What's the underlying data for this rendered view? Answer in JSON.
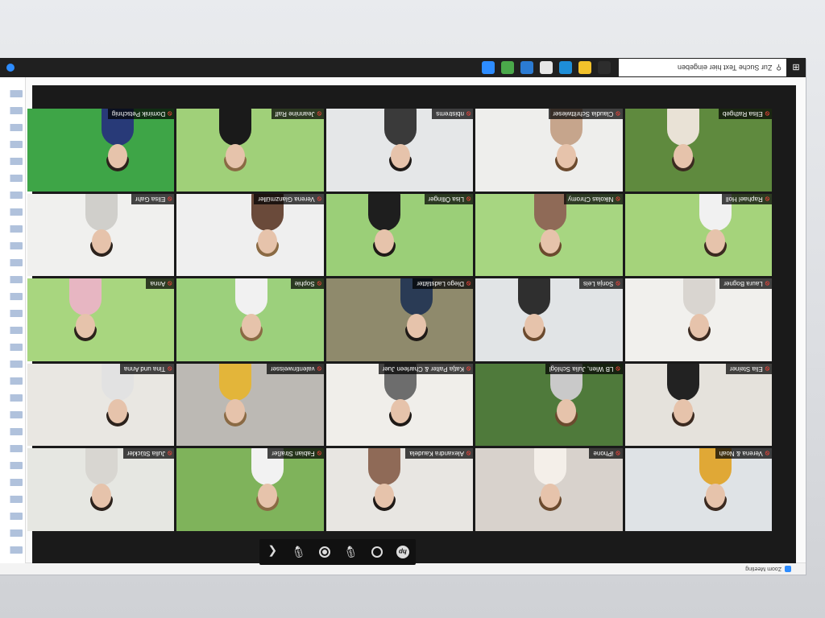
{
  "zoom_window": {
    "title": "Zoom Meeting"
  },
  "toolbar": {
    "items": [
      "hp-logo",
      "ring",
      "mic-icon",
      "record",
      "mic-icon",
      "chevron"
    ]
  },
  "participants": [
    {
      "name": "Verena & Noah",
      "scene": "#dfe3e6",
      "shirt": "#e0a836"
    },
    {
      "name": "iPhone",
      "scene": "#d8d2cc",
      "shirt": "#f4efe9"
    },
    {
      "name": "Alexandra Kaudela",
      "scene": "#e8e6e2",
      "shirt": "#8f6a57"
    },
    {
      "name": "Fabian Straßer",
      "scene": "#7fb35b",
      "shirt": "#f2f2f2"
    },
    {
      "name": "Julia Stückler",
      "scene": "#e6e7e2",
      "shirt": "#d8d6d1"
    },
    {
      "name": "Elia Steiner",
      "scene": "#e5e2dc",
      "shirt": "#222222"
    },
    {
      "name": "LB Wien, Julia Schlögl",
      "scene": "#4f7a3b",
      "shirt": "#c9c9c9"
    },
    {
      "name": "Katja Palter & Charleen Juer",
      "scene": "#f0eeea",
      "shirt": "#6d6d6d"
    },
    {
      "name": "valentinweisser",
      "scene": "#bcb9b4",
      "shirt": "#e3b53a"
    },
    {
      "name": "Tina und Anna",
      "scene": "#e9e7e2",
      "shirt": "#e2e2e2"
    },
    {
      "name": "Laura Bogner",
      "scene": "#f1f0ed",
      "shirt": "#d9d5d0"
    },
    {
      "name": "Sonja Leis",
      "scene": "#e1e4e6",
      "shirt": "#2f2f2f"
    },
    {
      "name": "Diego Ladstätter",
      "scene": "#8f8a6c",
      "shirt": "#2a3b55"
    },
    {
      "name": "Sophie",
      "scene": "#9cd07c",
      "shirt": "#f1f1f1"
    },
    {
      "name": "Anna",
      "scene": "#a8d67f",
      "shirt": "#e7b6c2"
    },
    {
      "name": "Raphael Holl",
      "scene": "#a5d37b",
      "shirt": "#f1f1f1"
    },
    {
      "name": "Nikolas Chromy",
      "scene": "#a7d681",
      "shirt": "#8f6a57"
    },
    {
      "name": "Lisa Öllinger",
      "scene": "#9bcf78",
      "shirt": "#1e1e1e"
    },
    {
      "name": "Verena Glanzmüller",
      "scene": "#efefef",
      "shirt": "#6a4a3a"
    },
    {
      "name": "Elisa Gahr",
      "scene": "#f0f0ee",
      "shirt": "#d0cfcb"
    },
    {
      "name": "Elisa Rathgeb",
      "scene": "#5f8a3e",
      "shirt": "#e9e2d6"
    },
    {
      "name": "Claudia Schrittwieser",
      "scene": "#eeeeec",
      "shirt": "#c6a58c"
    },
    {
      "name": "nbistrems",
      "scene": "#e5e7e8",
      "shirt": "#3a3a3a"
    },
    {
      "name": "Jeannine Ralf",
      "scene": "#a0d079",
      "shirt": "#1a1a1a"
    },
    {
      "name": "Dominik Petschnig",
      "scene": "#3ea547",
      "shirt": "#283a78"
    }
  ],
  "taskbar": {
    "search_placeholder": "Zur Suche Text hier eingeben",
    "apps": [
      {
        "icon": "task-view-icon",
        "color": "#2d2d2d"
      },
      {
        "icon": "file-explorer-icon",
        "color": "#f3c22b"
      },
      {
        "icon": "edge-icon",
        "color": "#1e8ed8"
      },
      {
        "icon": "store-icon",
        "color": "#e6e6e6"
      },
      {
        "icon": "mail-icon",
        "color": "#2b7bd3"
      },
      {
        "icon": "chrome-icon",
        "color": "#4aa84a"
      },
      {
        "icon": "zoom-icon",
        "color": "#2d8cff"
      }
    ]
  }
}
